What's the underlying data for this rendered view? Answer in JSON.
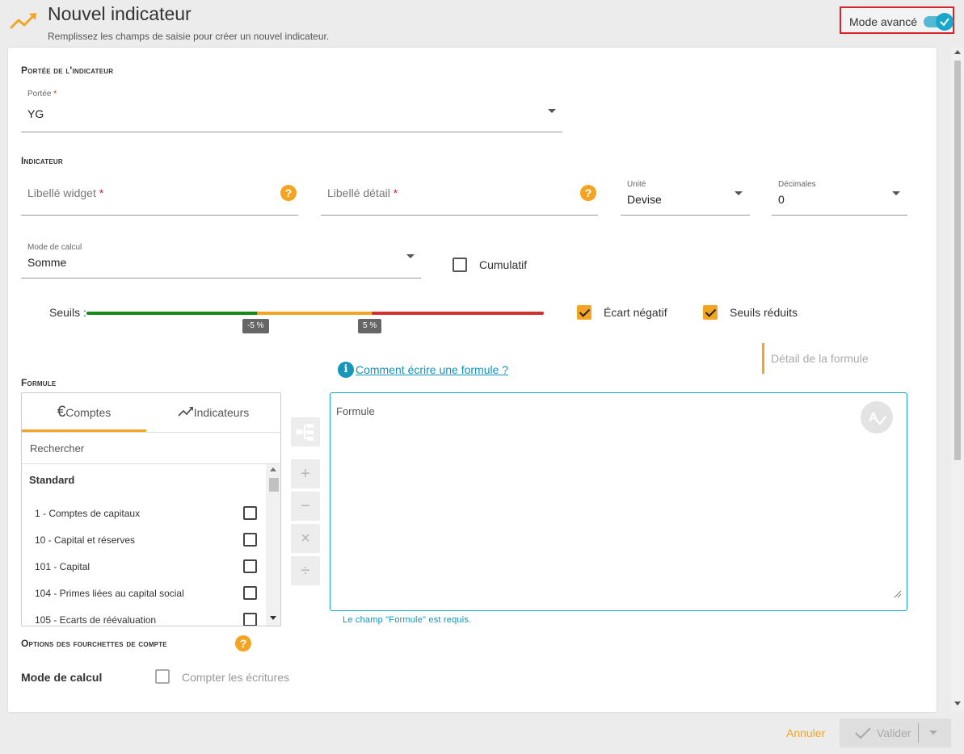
{
  "header": {
    "title": "Nouvel indicateur",
    "subtitle": "Remplissez les champs de saisie pour créer un nouvel indicateur.",
    "mode_label": "Mode avancé",
    "mode_enabled": true
  },
  "scope": {
    "section_title": "Portée de l'indicateur",
    "label": "Portée",
    "required_mark": "*",
    "value": "YG"
  },
  "indicator": {
    "section_title": "Indicateur",
    "widget_label": "Libellé widget",
    "detail_label": "Libellé détail",
    "required_mark": "*",
    "help_glyph": "?",
    "unit_label": "Unité",
    "unit_value": "Devise",
    "decimals_label": "Décimales",
    "decimals_value": "0",
    "calc_mode_label": "Mode de calcul",
    "calc_mode_value": "Somme",
    "cumulative_label": "Cumulatif",
    "cumulative_checked": false
  },
  "thresholds": {
    "label": "Seuils :",
    "low_label": "-5 %",
    "high_label": "5 %",
    "low_value": -5,
    "high_value": 5,
    "negative_gap_label": "Écart négatif",
    "negative_gap_checked": true,
    "reduced_label": "Seuils réduits",
    "reduced_checked": true,
    "colors": {
      "green": "#148a14",
      "orange": "#f4a423",
      "red": "#d43030"
    }
  },
  "formula": {
    "section_title": "Formule",
    "help_link": "Comment écrire une formule ?",
    "detail_label": "Détail de la formule",
    "placeholder": "Formule",
    "error": "Le champ \"Formule\" est requis.",
    "tabs": [
      {
        "label": "Comptes",
        "icon": "euro-icon"
      },
      {
        "label": "Indicateurs",
        "icon": "trend-icon"
      }
    ],
    "search_placeholder": "Rechercher",
    "group_title": "Standard",
    "accounts": [
      "1 - Comptes de capitaux",
      "10 - Capital et réserves",
      "101 - Capital",
      "104 - Primes liées au capital social",
      "105 - Ecarts de réévaluation"
    ],
    "operators": [
      "+",
      "−",
      "×",
      "÷"
    ]
  },
  "range_options": {
    "section_title": "Options des fourchettes de compte",
    "calc_mode_label": "Mode de calcul",
    "count_entries_label": "Compter les écritures"
  },
  "footer": {
    "cancel_label": "Annuler",
    "validate_label": "Valider"
  }
}
